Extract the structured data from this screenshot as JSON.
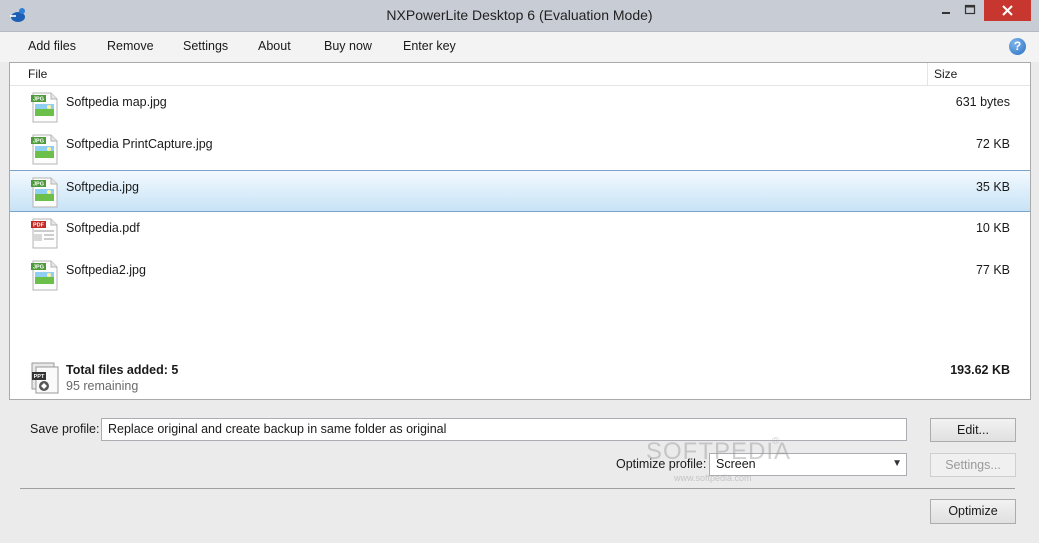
{
  "window": {
    "title": "NXPowerLite Desktop 6 (Evaluation Mode)",
    "icons": [
      "app-logo-icon",
      "minimize-icon",
      "maximize-icon",
      "close-icon"
    ]
  },
  "menu": {
    "add_files": "Add files",
    "remove": "Remove",
    "settings": "Settings",
    "about": "About",
    "buy_now": "Buy now",
    "enter_key": "Enter key",
    "help_glyph": "?"
  },
  "file_list": {
    "columns": {
      "file": "File",
      "size": "Size"
    },
    "rows": [
      {
        "name": "Softpedia map.jpg",
        "size": "631 bytes",
        "type_badge": "JPG",
        "icon": "jpg-file-icon"
      },
      {
        "name": "Softpedia PrintCapture.jpg",
        "size": "72 KB",
        "type_badge": "JPG",
        "icon": "jpg-file-icon"
      },
      {
        "name": "Softpedia.jpg",
        "size": "35 KB",
        "type_badge": "JPG",
        "icon": "jpg-file-icon",
        "selected": true
      },
      {
        "name": "Softpedia.pdf",
        "size": "10 KB",
        "type_badge": "PDF",
        "icon": "pdf-file-icon"
      },
      {
        "name": "Softpedia2.jpg",
        "size": "77 KB",
        "type_badge": "JPG",
        "icon": "jpg-file-icon"
      }
    ]
  },
  "totals": {
    "label": "Total files added: 5",
    "remaining": "95 remaining",
    "size": "193.62 KB",
    "icon": "multiple-files-icon",
    "icon_badge": "PPT"
  },
  "save_profile": {
    "label": "Save profile:",
    "value": "Replace original and create backup in same folder as original",
    "edit_button": "Edit..."
  },
  "optimize_profile": {
    "label": "Optimize profile:",
    "value": "Screen",
    "settings_button": "Settings...",
    "settings_enabled": false
  },
  "optimize_button": "Optimize",
  "watermark": {
    "text": "SOFTPEDIA",
    "url": "www.softpedia.com",
    "mark": "®"
  },
  "colors": {
    "title_bar": "#c8ccd4",
    "close_button": "#c7372f",
    "selection_top": "#f3f9fe",
    "selection_bottom": "#c7e3f6",
    "selection_border": "#7da2ce",
    "jpg_badge": "#4f9a3b",
    "pdf_badge": "#c12a25"
  }
}
